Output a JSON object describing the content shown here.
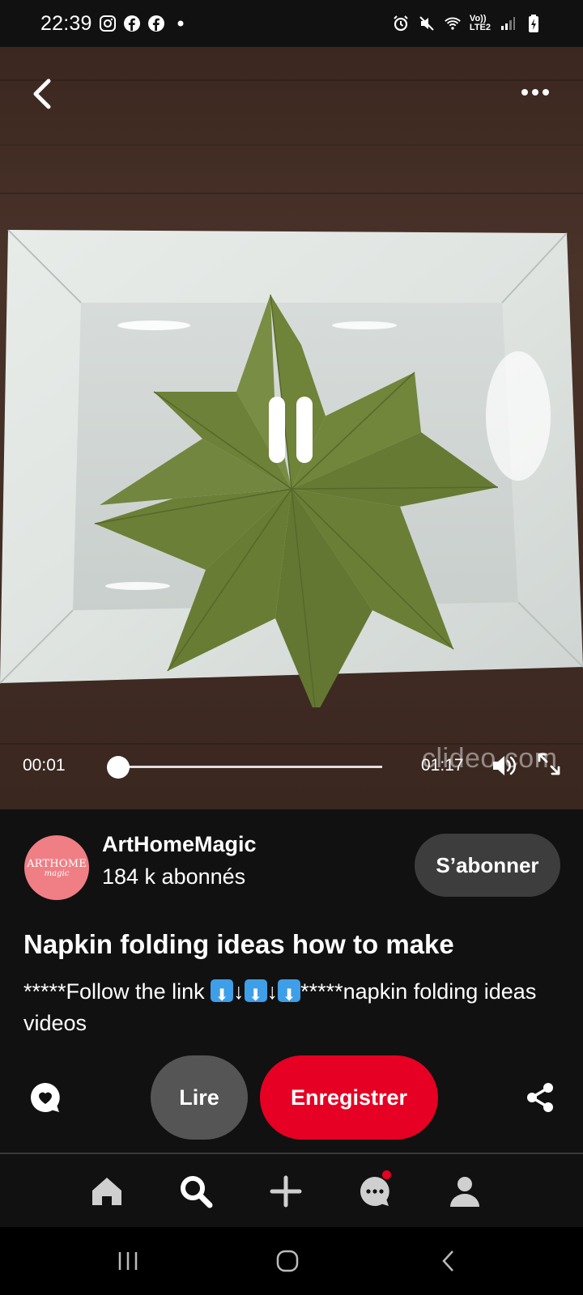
{
  "status_bar": {
    "time": "22:39",
    "left_icons": [
      "instagram-icon",
      "facebook-icon",
      "facebook-icon",
      "dot-icon"
    ],
    "right_icons": [
      "alarm-icon",
      "mute-icon",
      "wifi-icon",
      "signal-icon",
      "battery-charging-icon"
    ],
    "network_label": "LTE2",
    "volte_label": "Vo))"
  },
  "video": {
    "current_time": "00:01",
    "total_time": "01:17",
    "progress_fraction": 0.013,
    "watermark": "clideo.com",
    "icons": {
      "back": "back-chevron-icon",
      "more": "more-dots-icon",
      "pause": "pause-icon",
      "volume": "volume-icon",
      "fullscreen": "expand-icon"
    }
  },
  "creator": {
    "avatar_text_1": "ARTHOME",
    "avatar_text_2": "magic",
    "name": "ArtHomeMagic",
    "followers": "184 k abonnés",
    "follow_label": "S’abonner"
  },
  "pin": {
    "title": "Napkin folding ideas how to make",
    "desc_prefix": "*****Follow the link ",
    "desc_suffix": "*****napkin folding ideas videos"
  },
  "actions": {
    "read_label": "Lire",
    "save_label": "Enregistrer",
    "comment_icon": "comment-heart-icon",
    "share_icon": "share-icon"
  },
  "bottom_nav": {
    "items": [
      "home-icon",
      "search-icon",
      "plus-icon",
      "messages-icon",
      "profile-icon"
    ],
    "active": "search-icon",
    "badge_on": "messages-icon"
  },
  "colors": {
    "accent": "#e60023",
    "background": "#111111",
    "secondary_button": "#555555",
    "follow_button": "#3d3d3d",
    "avatar_bg": "#ef7f85",
    "napkin_green": "#6b7e3a"
  }
}
